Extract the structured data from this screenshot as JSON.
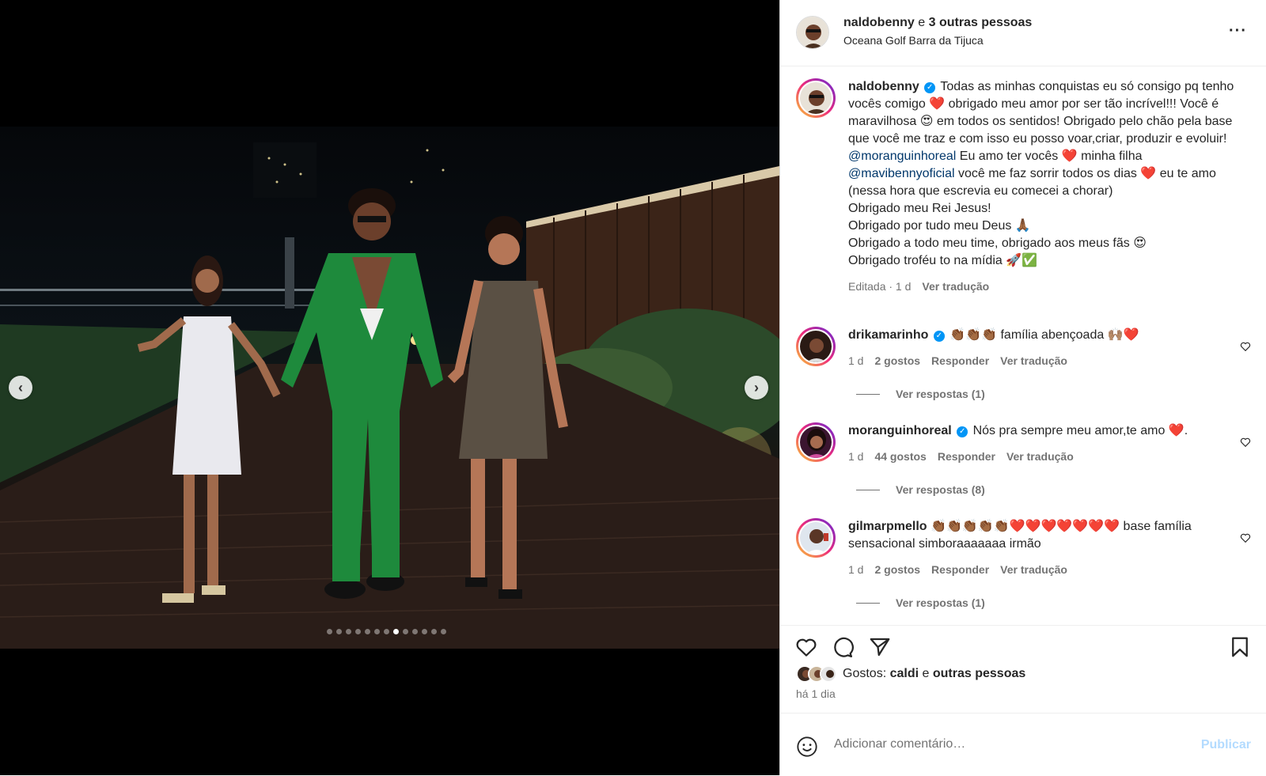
{
  "header": {
    "username": "naldobenny",
    "joiner": "e",
    "others": "3 outras pessoas",
    "location": "Oceana Golf Barra da Tijuca"
  },
  "carousel": {
    "count": 13,
    "active": 7
  },
  "caption": {
    "username": "naldobenny",
    "p1": "Todas as minhas conquistas eu só consigo pq tenho vocês comigo",
    "p2": "obrigado meu amor por ser tão incrível!!! Você é maravilhosa",
    "p3": "em todos os sentidos! Obrigado pelo chão pela base que você me traz e com isso eu posso voar,criar, produzir e evoluir!",
    "mention1": "@moranguinhoreal",
    "p4": "Eu amo ter vocês",
    "p5": "minha filha",
    "mention2": "@mavibennyoficial",
    "p6": "você me faz sorrir todos os dias",
    "p7": "eu te amo (nessa hora que escrevia eu comecei a chorar)",
    "l1": "Obrigado meu Rei Jesus!",
    "l2": "Obrigado por tudo meu Deus 🙏🏾",
    "l3": "Obrigado a todo meu time, obrigado aos meus fãs 😍",
    "l4": "Obrigado troféu to na mídia 🚀✅",
    "meta_edited": "Editada · 1 d",
    "meta_translate": "Ver tradução"
  },
  "comments": [
    {
      "username": "drikamarinho",
      "text": "👏🏾👏🏾👏🏾 família abençoada 🙌🏽❤️",
      "time": "1 d",
      "likes": "2 gostos",
      "reply": "Responder",
      "translate": "Ver tradução",
      "replies": "Ver respostas (1)"
    },
    {
      "username": "moranguinhoreal",
      "text": "Nós pra sempre meu amor,te amo ❤️.",
      "time": "1 d",
      "likes": "44 gostos",
      "reply": "Responder",
      "translate": "Ver tradução",
      "replies": "Ver respostas (8)"
    },
    {
      "username": "gilmarpmello",
      "text": "👏🏾👏🏾👏🏾👏🏾👏🏾❤️❤️❤️❤️❤️❤️❤️ base família sensacional simboraaaaaaa irmão",
      "time": "1 d",
      "likes": "2 gostos",
      "reply": "Responder",
      "translate": "Ver tradução",
      "replies": "Ver respostas (1)"
    }
  ],
  "likes": {
    "prefix": "Gostos:",
    "name": "caldi",
    "joiner": "e",
    "others": "outras pessoas"
  },
  "post_time": "há 1 dia",
  "composer": {
    "placeholder": "Adicionar comentário…",
    "publish": "Publicar"
  },
  "colors": {
    "link": "#00376b",
    "verified": "#0095f6",
    "muted": "#737373",
    "publish_disabled": "#b3dbff"
  }
}
